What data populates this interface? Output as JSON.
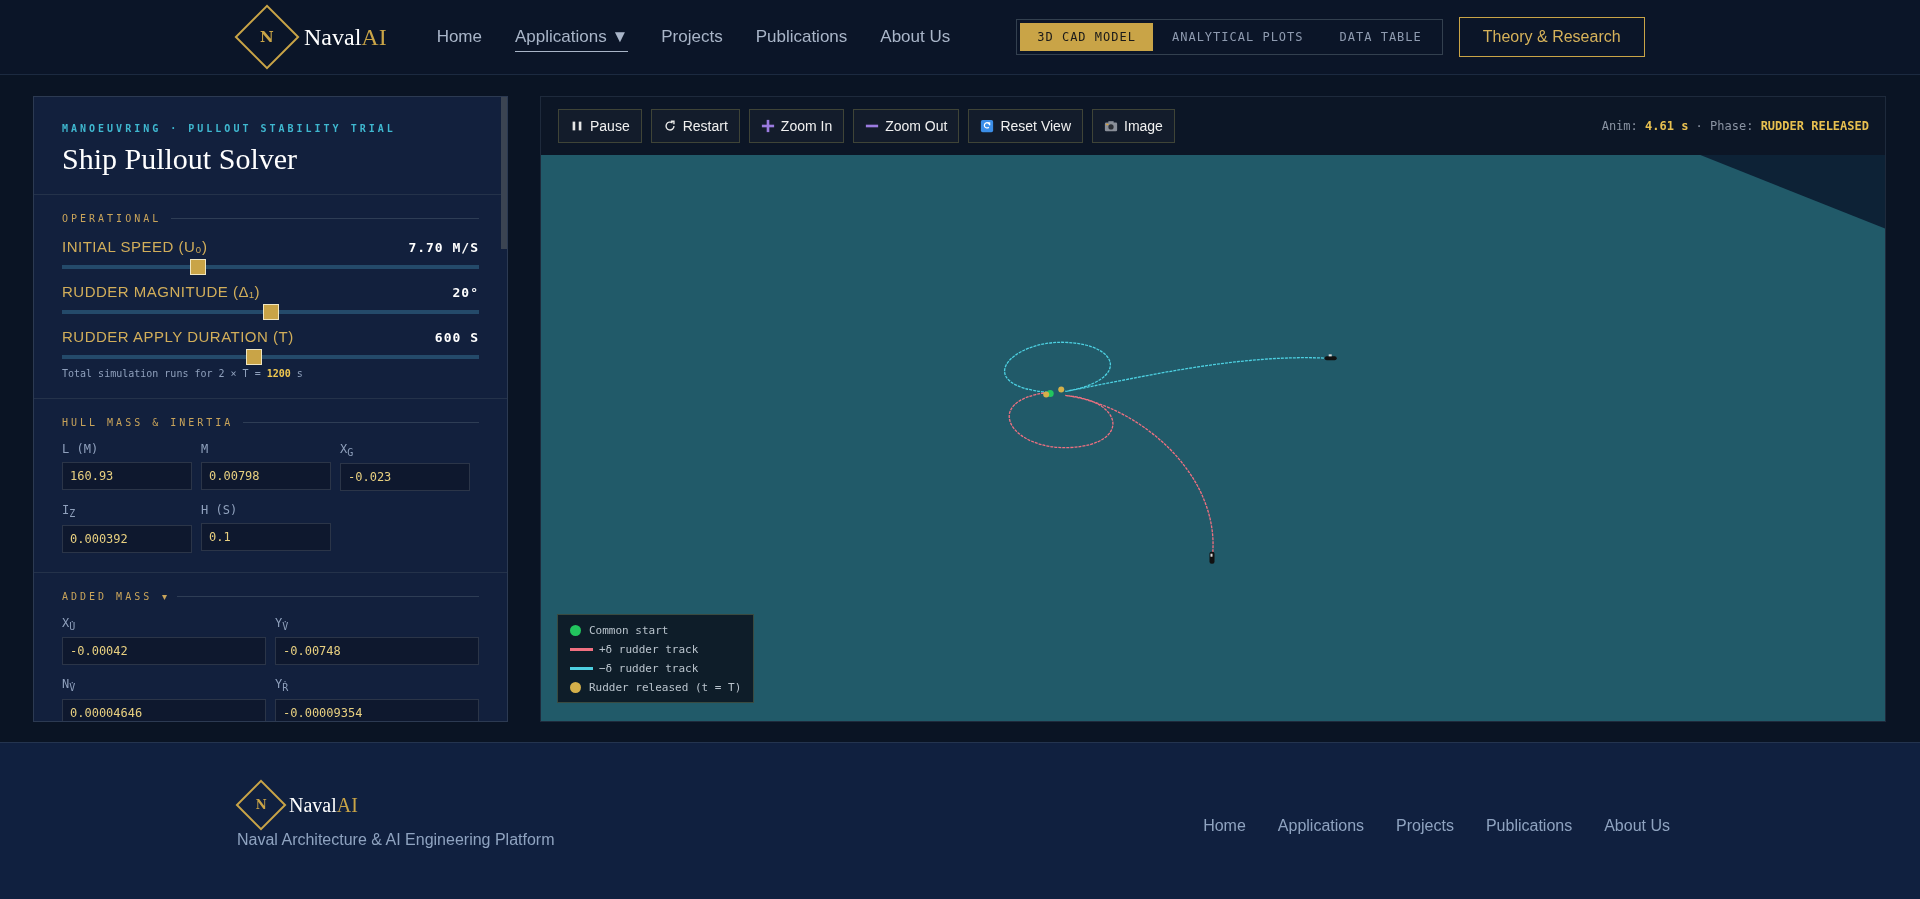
{
  "header": {
    "logo": {
      "mark": "N",
      "name": "Naval",
      "accent": "AI"
    },
    "nav": [
      {
        "label": "Home",
        "selected": false
      },
      {
        "label": "Applications ▼",
        "selected": true
      },
      {
        "label": "Projects",
        "selected": false
      },
      {
        "label": "Publications",
        "selected": false
      },
      {
        "label": "About Us",
        "selected": false
      }
    ],
    "view_tabs": [
      {
        "label": "3D CAD MODEL",
        "selected": true
      },
      {
        "label": "ANALYTICAL PLOTS",
        "selected": false
      },
      {
        "label": "DATA TABLE",
        "selected": false
      }
    ],
    "cta": "Theory & Research"
  },
  "panel": {
    "eyebrow": "MANOEUVRING · PULLOUT STABILITY TRIAL",
    "title": "Ship Pullout Solver",
    "sections": [
      {
        "kind": "sliders",
        "title": "OPERATIONAL",
        "sliders": [
          {
            "label": "INITIAL SPEED (U₀)",
            "reading": "7.70 M/S",
            "level": 0.32
          },
          {
            "label": "RUDDER MAGNITUDE (Δ₁)",
            "reading": "20°",
            "level": 0.5
          },
          {
            "label": "RUDDER APPLY DURATION (T)",
            "reading": "600 S",
            "level": 0.46
          }
        ],
        "note": "Total simulation runs for 2 × T = **1200** s"
      },
      {
        "kind": "grid3",
        "title": "HULL MASS & INERTIA",
        "fields": [
          {
            "label": "L (M)",
            "value": "160.93"
          },
          {
            "label": "M",
            "value": "0.00798"
          },
          {
            "label": "X$_{G}$",
            "value": "-0.023"
          },
          {
            "label": "I$_{Z}$",
            "value": "0.000392"
          },
          {
            "label": "H (S)",
            "value": "0.1"
          }
        ]
      },
      {
        "kind": "grid2",
        "title": "ADDED MASS",
        "caret": "▾",
        "fields": [
          {
            "label": "X$_{U̇}$",
            "value": "-0.00042"
          },
          {
            "label": "Y$_{V̇}$",
            "value": "-0.00748"
          },
          {
            "label": "N$_{V̇}$",
            "value": "0.00004646"
          },
          {
            "label": "Y$_{Ṙ}$",
            "value": "-0.00009354"
          }
        ]
      }
    ]
  },
  "viewer": {
    "toolbar": [
      {
        "label": "Pause"
      },
      {
        "label": "Restart"
      },
      {
        "label": "Zoom In"
      },
      {
        "label": "Zoom Out"
      },
      {
        "label": "Reset View"
      },
      {
        "label": "Image"
      }
    ],
    "status": "Anim: **4.61 s** · Phase: **RUDDER RELEASED**",
    "legend": [
      {
        "kind": "dot",
        "color": "#22c55e",
        "label": "Common start"
      },
      {
        "kind": "line",
        "color": "#f07080",
        "label": "+δ rudder track"
      },
      {
        "kind": "line",
        "color": "#4dd0e1",
        "label": "−δ rudder track"
      },
      {
        "kind": "dot",
        "color": "#d4b04a",
        "label": "Rudder released (t = T)"
      }
    ]
  },
  "footer": {
    "logo": {
      "mark": "N",
      "name": "Naval",
      "accent": "AI"
    },
    "tagline": "Naval Architecture & AI Engineering Platform",
    "links": [
      "Home",
      "Applications",
      "Projects",
      "Publications",
      "About Us"
    ]
  }
}
